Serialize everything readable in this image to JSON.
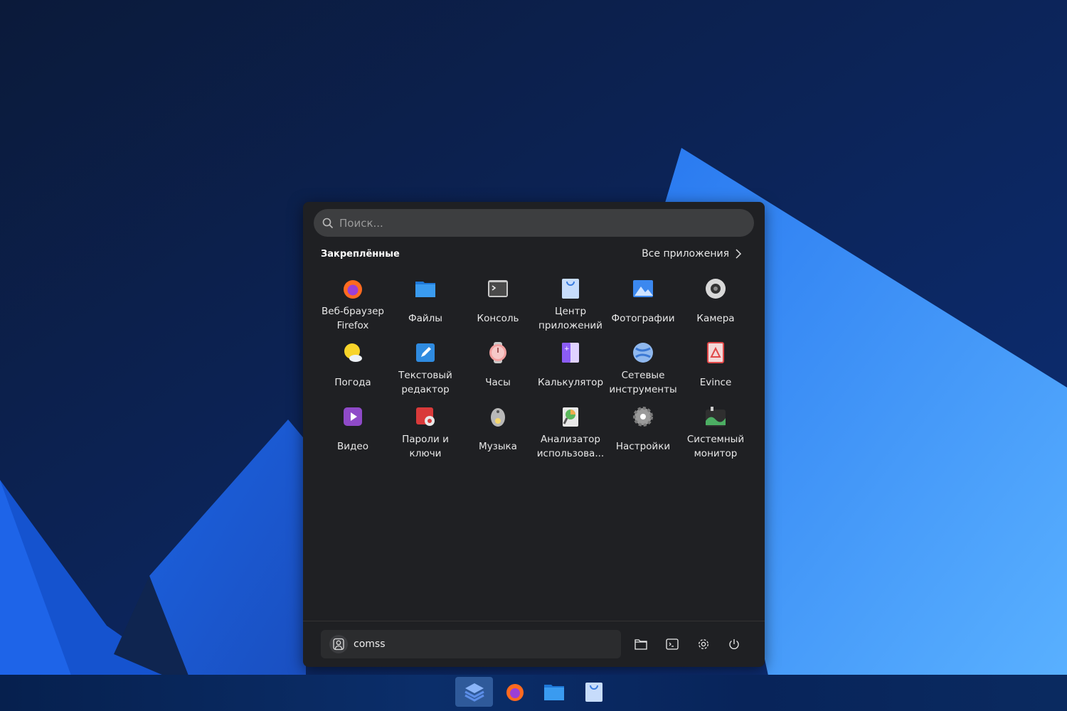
{
  "search": {
    "placeholder": "Поиск..."
  },
  "pinned": {
    "title": "Закреплённые",
    "all_apps": "Все приложения"
  },
  "apps": [
    {
      "label": "Веб-браузер Firefox",
      "icon": "firefox-icon"
    },
    {
      "label": "Файлы",
      "icon": "files-icon"
    },
    {
      "label": "Консоль",
      "icon": "console-icon"
    },
    {
      "label": "Центр приложений",
      "icon": "app-center-icon"
    },
    {
      "label": "Фотографии",
      "icon": "photos-icon"
    },
    {
      "label": "Камера",
      "icon": "camera-icon"
    },
    {
      "label": "Погода",
      "icon": "weather-icon"
    },
    {
      "label": "Текстовый редактор",
      "icon": "text-editor-icon"
    },
    {
      "label": "Часы",
      "icon": "clock-icon"
    },
    {
      "label": "Калькулятор",
      "icon": "calculator-icon"
    },
    {
      "label": "Сетевые инструменты",
      "icon": "network-tools-icon"
    },
    {
      "label": "Evince",
      "icon": "evince-icon"
    },
    {
      "label": "Видео",
      "icon": "video-icon"
    },
    {
      "label": "Пароли и ключи",
      "icon": "passwords-icon"
    },
    {
      "label": "Музыка",
      "icon": "music-icon"
    },
    {
      "label": "Анализатор использова...",
      "icon": "disk-usage-icon"
    },
    {
      "label": "Настройки",
      "icon": "settings-icon"
    },
    {
      "label": "Системный монитор",
      "icon": "system-monitor-icon"
    }
  ],
  "user": {
    "name": "comss"
  },
  "colors": {
    "accent": "#3584e4",
    "panel": "#1f2023"
  }
}
